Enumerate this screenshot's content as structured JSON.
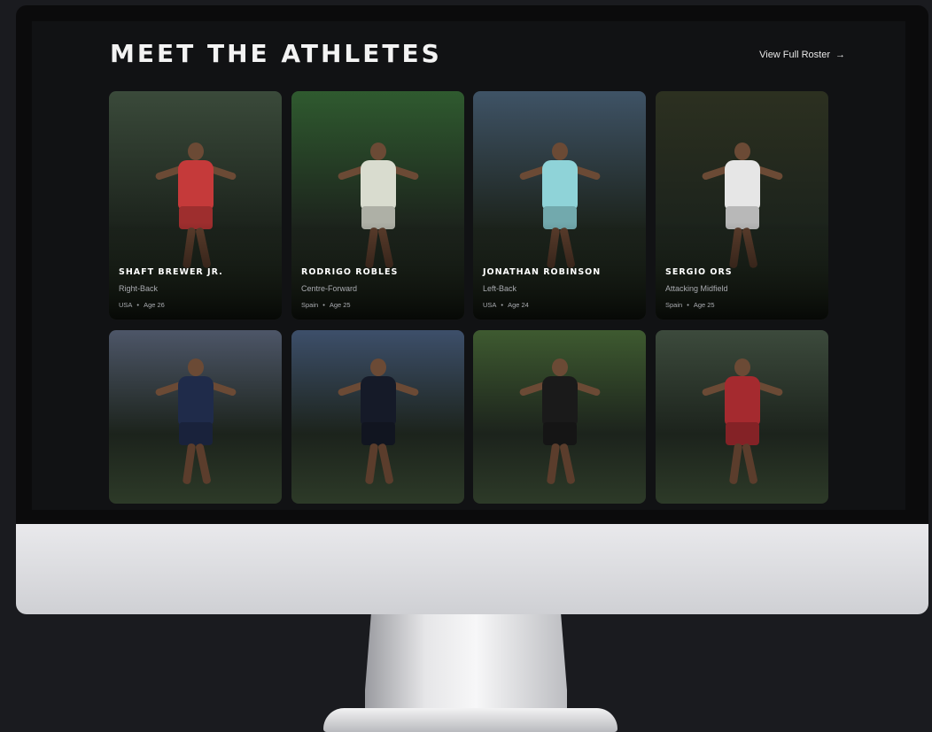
{
  "section": {
    "title": "MEET THE ATHLETES",
    "roster_link": "View Full Roster",
    "roster_arrow": "→"
  },
  "athletes": [
    {
      "name": "SHAFT BREWER JR.",
      "position": "Right-Back",
      "country": "USA",
      "age": "Age 26",
      "kit_color": "#c53a3a",
      "bg": "#3a4a3a"
    },
    {
      "name": "RODRIGO ROBLES",
      "position": "Centre-Forward",
      "country": "Spain",
      "age": "Age 25",
      "kit_color": "#d9dccf",
      "bg": "#2f5a2f"
    },
    {
      "name": "JONATHAN ROBINSON",
      "position": "Left-Back",
      "country": "USA",
      "age": "Age 24",
      "kit_color": "#8fd3d8",
      "bg": "#3f5366"
    },
    {
      "name": "SERGIO ORS",
      "position": "Attacking Midfield",
      "country": "Spain",
      "age": "Age 25",
      "kit_color": "#e6e6e6",
      "bg": "#2c3020"
    },
    {
      "kit_color": "#1f2b4a",
      "bg": "#4d5668"
    },
    {
      "kit_color": "#151a28",
      "bg": "#3d4f6a"
    },
    {
      "kit_color": "#1a1a1a",
      "bg": "#3e5a30"
    },
    {
      "kit_color": "#a52a2f",
      "bg": "#3c4a3c"
    }
  ],
  "meta_separator": "•"
}
